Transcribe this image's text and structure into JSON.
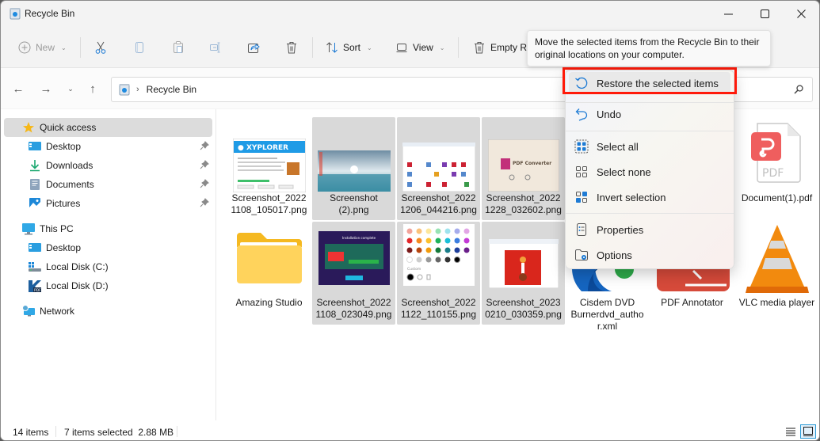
{
  "window": {
    "title": "Recycle Bin",
    "controls": {
      "minimize": "minimize",
      "maximize": "maximize",
      "close": "close"
    }
  },
  "toolbar": {
    "new_label": "New",
    "sort_label": "Sort",
    "view_label": "View",
    "empty_label": "Empty R"
  },
  "address": {
    "crumb": "Recycle Bin",
    "search_placeholder": ""
  },
  "sidebar": {
    "items": [
      {
        "label": "Quick access",
        "icon": "star-icon",
        "active": true,
        "pinned": false
      },
      {
        "label": "Desktop",
        "icon": "desktop-icon",
        "pinned": true
      },
      {
        "label": "Downloads",
        "icon": "download-icon",
        "pinned": true
      },
      {
        "label": "Documents",
        "icon": "documents-icon",
        "pinned": true
      },
      {
        "label": "Pictures",
        "icon": "pictures-icon",
        "pinned": true
      },
      {
        "label": "This PC",
        "icon": "pc-icon"
      },
      {
        "label": "Desktop",
        "icon": "desktop-icon"
      },
      {
        "label": "Local Disk (C:)",
        "icon": "drive-c-icon"
      },
      {
        "label": "Local Disk (D:)",
        "icon": "drive-d-icon"
      },
      {
        "label": "Network",
        "icon": "network-icon"
      }
    ]
  },
  "files": [
    {
      "line1": "Screenshot_2022",
      "line2": "1108_105017.png",
      "line3": "",
      "selected": false,
      "kind": "xyplorer-screenshot"
    },
    {
      "line1": "Screenshot",
      "line2": "(2).png",
      "line3": "",
      "selected": true,
      "kind": "landscape-screenshot"
    },
    {
      "line1": "Screenshot_2022",
      "line2": "1206_044216.png",
      "line3": "",
      "selected": true,
      "kind": "grid-screenshot"
    },
    {
      "line1": "Screenshot_2022",
      "line2": "1228_032602.png",
      "line3": "",
      "selected": true,
      "kind": "pdf-converter-screenshot"
    },
    {
      "line1": "Document(1).pdf",
      "line2": "",
      "line3": "",
      "selected": false,
      "kind": "pdf-file"
    },
    {
      "line1": "Amazing Studio",
      "line2": "",
      "line3": "",
      "selected": false,
      "kind": "folder"
    },
    {
      "line1": "Screenshot_2022",
      "line2": "1108_023049.png",
      "line3": "",
      "selected": true,
      "kind": "dark-installer-screenshot"
    },
    {
      "line1": "Screenshot_2022",
      "line2": "1122_110155.png",
      "line3": "",
      "selected": true,
      "kind": "color-palette-screenshot"
    },
    {
      "line1": "Screenshot_2023",
      "line2": "0210_030359.png",
      "line3": "",
      "selected": true,
      "kind": "red-image-screenshot"
    },
    {
      "line1": "Cisdem DVD",
      "line2": "Burnerdvd_autho",
      "line3": "r.xml",
      "selected": false,
      "kind": "edge-xml"
    },
    {
      "line1": "PDF Annotator",
      "line2": "",
      "line3": "",
      "selected": false,
      "kind": "pdf-annotator-app"
    },
    {
      "line1": "VLC media player",
      "line2": "",
      "line3": "",
      "selected": false,
      "kind": "vlc-app"
    }
  ],
  "tooltip": {
    "line1": "Move the selected items from the Recycle Bin to their",
    "line2": "original locations on your computer."
  },
  "menu": {
    "items": [
      {
        "label": "Restore the selected items",
        "icon": "restore-icon",
        "highlighted": true
      },
      {
        "label": "Undo",
        "icon": "undo-icon"
      },
      {
        "label": "Select all",
        "icon": "select-all-icon"
      },
      {
        "label": "Select none",
        "icon": "select-none-icon"
      },
      {
        "label": "Invert selection",
        "icon": "invert-selection-icon"
      },
      {
        "label": "Properties",
        "icon": "properties-icon"
      },
      {
        "label": "Options",
        "icon": "options-icon"
      }
    ]
  },
  "status": {
    "item_count": "14 items",
    "selection": "7 items selected  2.88 MB"
  },
  "colors": {
    "accent": "#0067c0",
    "highlight_box": "#ff1a0a",
    "selected_tile": "#d9d9d9"
  }
}
